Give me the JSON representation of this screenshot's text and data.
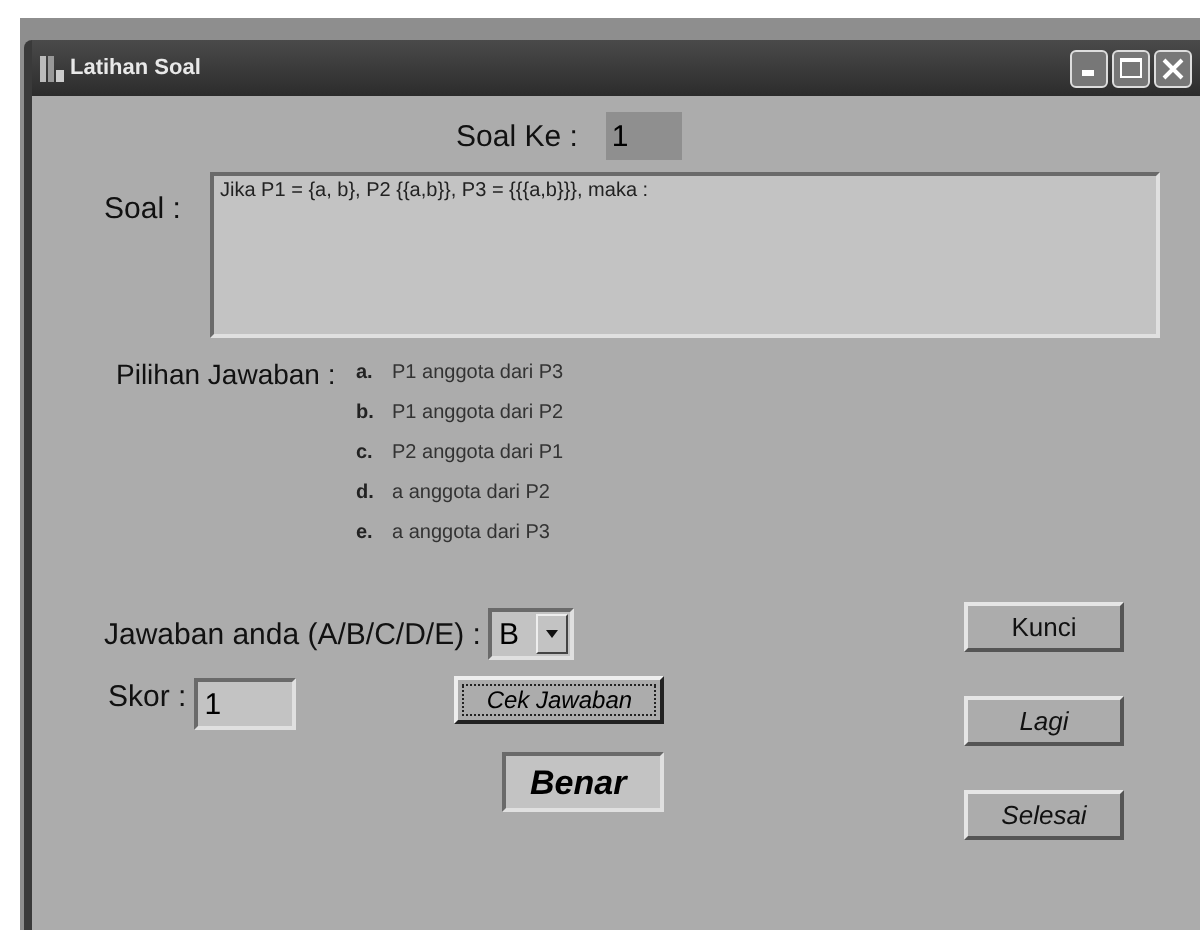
{
  "window": {
    "title": "Latihan Soal"
  },
  "question_number": {
    "label": "Soal Ke :",
    "value": "1"
  },
  "question": {
    "label": "Soal :",
    "value": "Jika P1 = {a, b}, P2  {{a,b}}, P3 = {{{a,b}}}, maka :"
  },
  "choices": {
    "label": "Pilihan Jawaban :",
    "items": [
      {
        "letter": "a.",
        "text": "P1 anggota dari P3"
      },
      {
        "letter": "b.",
        "text": "P1 anggota dari P2"
      },
      {
        "letter": "c.",
        "text": "P2 anggota dari P1"
      },
      {
        "letter": "d.",
        "text": "a anggota dari P2"
      },
      {
        "letter": "e.",
        "text": "a anggota dari P3"
      }
    ]
  },
  "answer": {
    "label": "Jawaban anda (A/B/C/D/E) :",
    "value": "B"
  },
  "score": {
    "label": "Skor :",
    "value": "1"
  },
  "check_button": "Cek Jawaban",
  "result": "Benar",
  "side_buttons": [
    "Kunci",
    "Lagi",
    "Selesai"
  ]
}
